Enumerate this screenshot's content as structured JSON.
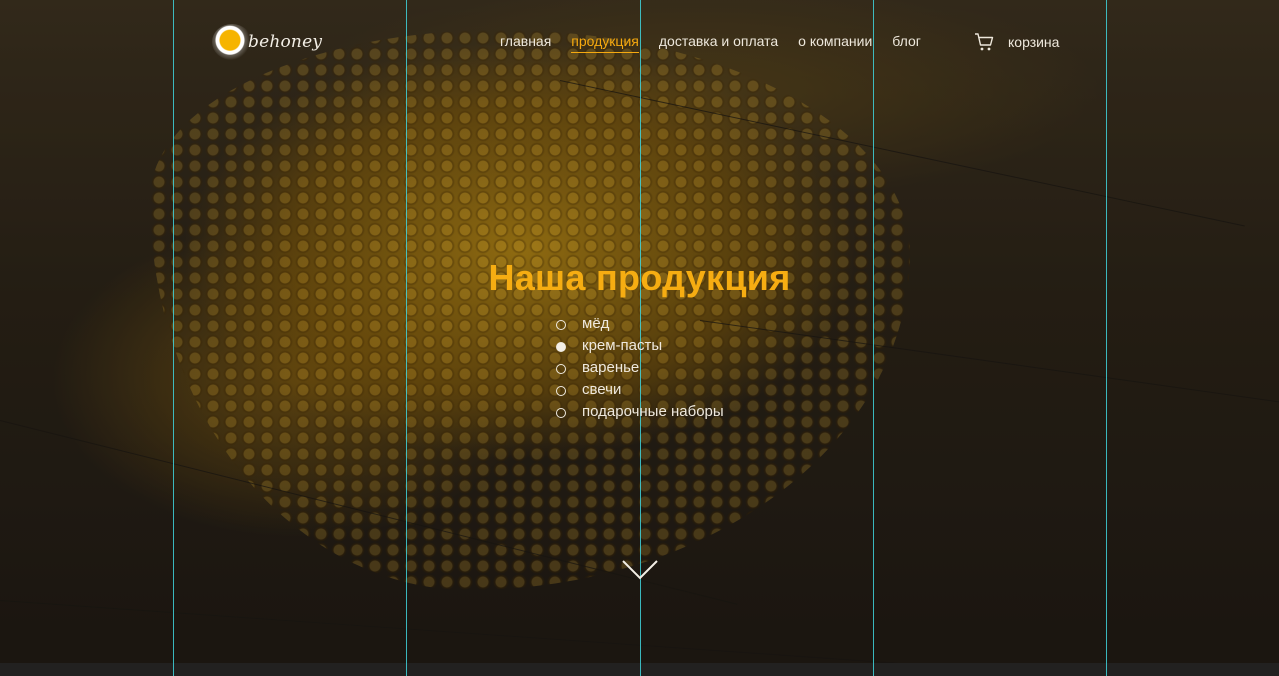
{
  "brand": {
    "logo_text": "behoney"
  },
  "nav": {
    "items": [
      {
        "label": "главная",
        "active": false
      },
      {
        "label": "продукция",
        "active": true
      },
      {
        "label": "доставка и оплата",
        "active": false
      },
      {
        "label": "о компании",
        "active": false
      },
      {
        "label": "блог",
        "active": false
      }
    ],
    "cart_label": "корзина",
    "accent_color": "#f6a90f"
  },
  "hero": {
    "title": "Наша продукция",
    "categories": [
      {
        "label": "мёд",
        "selected": false
      },
      {
        "label": "крем-пасты",
        "selected": true
      },
      {
        "label": "варенье",
        "selected": false
      },
      {
        "label": "свечи",
        "selected": false
      },
      {
        "label": "подарочные наборы",
        "selected": false
      }
    ],
    "scroll_icon": "chevron-down-icon"
  }
}
